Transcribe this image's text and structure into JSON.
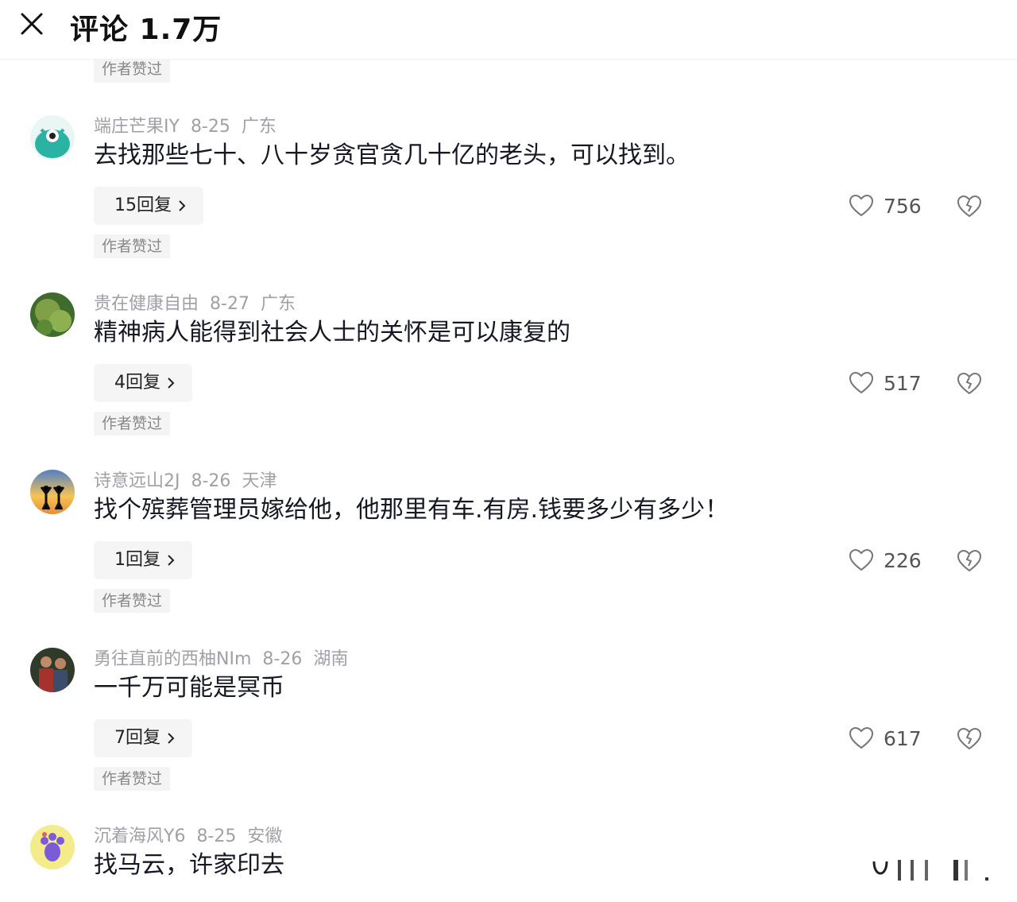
{
  "header": {
    "title": "评论 1.7万"
  },
  "top_badge": "作者赞过",
  "comments": [
    {
      "username": "端庄芒果IY",
      "date": "8-25",
      "location": "广东",
      "text": "去找那些七十、八十岁贪官贪几十亿的老头，可以找到。",
      "reply_label": "15回复",
      "likes": "756",
      "author_liked": "作者赞过",
      "avatar_icon": "teal-monster-avatar"
    },
    {
      "username": "贵在健康自由",
      "date": "8-27",
      "location": "广东",
      "text": "精神病人能得到社会人士的关怀是可以康复的",
      "reply_label": "4回复",
      "likes": "517",
      "author_liked": "作者赞过",
      "avatar_icon": "green-fruit-avatar"
    },
    {
      "username": "诗意远山2J",
      "date": "8-26",
      "location": "天津",
      "text": "找个殡葬管理员嫁给他，他那里有车.有房.钱要多少有多少！",
      "reply_label": "1回复",
      "likes": "226",
      "author_liked": "作者赞过",
      "avatar_icon": "sunset-couple-avatar"
    },
    {
      "username": "勇往直前的西柚NIm",
      "date": "8-26",
      "location": "湖南",
      "text": "一千万可能是冥币",
      "reply_label": "7回复",
      "likes": "617",
      "author_liked": "作者赞过",
      "avatar_icon": "people-photo-avatar"
    },
    {
      "username": "沉着海风Y6",
      "date": "8-25",
      "location": "安徽",
      "text": "找马云，许家印去",
      "avatar_icon": "purple-paw-avatar"
    }
  ],
  "colors": {
    "text_primary": "#161823",
    "text_secondary": "#a0a0a8",
    "badge_bg": "#f4f4f4"
  }
}
